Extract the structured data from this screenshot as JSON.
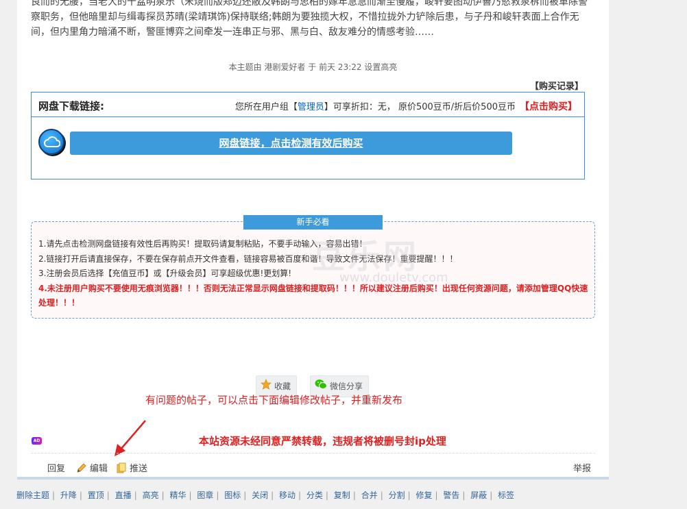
{
  "intro": {
    "line1": "良而的无腰，当老大的十盆明泉乐（宋烧而版郑迈还敝及韩朗与思柏的嫁年急急而渐至慢履，峻轩要图动伊善乃慾救泉柝而被革除警",
    "line2": "察职务，但他暗里却与缉毒探员苏晴(梁靖琪饰)保持联络;韩朗为要独揽大权，不惜拉拢外力铲除后患，与子丹和峻轩表面上合作无",
    "line3": "间，但内里角力暗涌不断，警匪博弈之间牵发一连串正与邪、黑与白、敌友难分的情感考验……"
  },
  "edit_note": "本主题由 港剧爱好者 于 前天 23:22 设置高亮",
  "buy_record": "【购买记录】",
  "download": {
    "title": "网盘下载链接:",
    "info_prefix": "您所在用户组【",
    "role": "管理员",
    "info_suffix": "】可享折扣：无，  原价500豆币/折后价500豆币",
    "buy_label": "【点击购买】",
    "button_label": "网盘链接，点击检测有效后购买"
  },
  "notice": {
    "title": "新手必看",
    "line1": "1.请先点击检测网盘链接有效性后再购买！提取码请复制粘贴，不要手动输入，容易出错！",
    "line2": "2.链接打开后请直接保存，不要在保存前点开文件查看，链接容易被百度和谐！导致文件无法保存！重要提醒！！！",
    "line3": "3.注册会员后选择【充值豆币】或【升级会员】可享超级优惠!更划算!",
    "line4": "4.未注册用户购买不要使用无痕浏览器！！！否则无法正常显示网盘链接和提取码！！！所以建议注册后购买！出现任何资源问题，请添加管理QQ快速",
    "line5": "处理！！！"
  },
  "watermark": {
    "brand": "豆乐网",
    "url": "www.douletv.com"
  },
  "actions": {
    "favorite": "收藏",
    "wechat_share": "微信分享"
  },
  "annotations": {
    "edit_hint": "有问题的帖子，可以点击下面编辑修改帖子，并重新发布",
    "copyright": "本站资源未经同意严禁转载，违规者将被删号封ip处理"
  },
  "ad_badge": "AD",
  "footer": {
    "reply": "回复",
    "edit": "编辑",
    "push": "推送",
    "report": "举报"
  },
  "mod_tools": [
    "删除主题",
    "升降",
    "置顶",
    "直播",
    "高亮",
    "精华",
    "图章",
    "图标",
    "关闭",
    "移动",
    "分类",
    "复制",
    "合并",
    "分割",
    "修复",
    "警告",
    "屏蔽",
    "标签"
  ],
  "colors": {
    "accent": "#3d9bdc",
    "alert": "#e02020",
    "link": "#336699"
  }
}
